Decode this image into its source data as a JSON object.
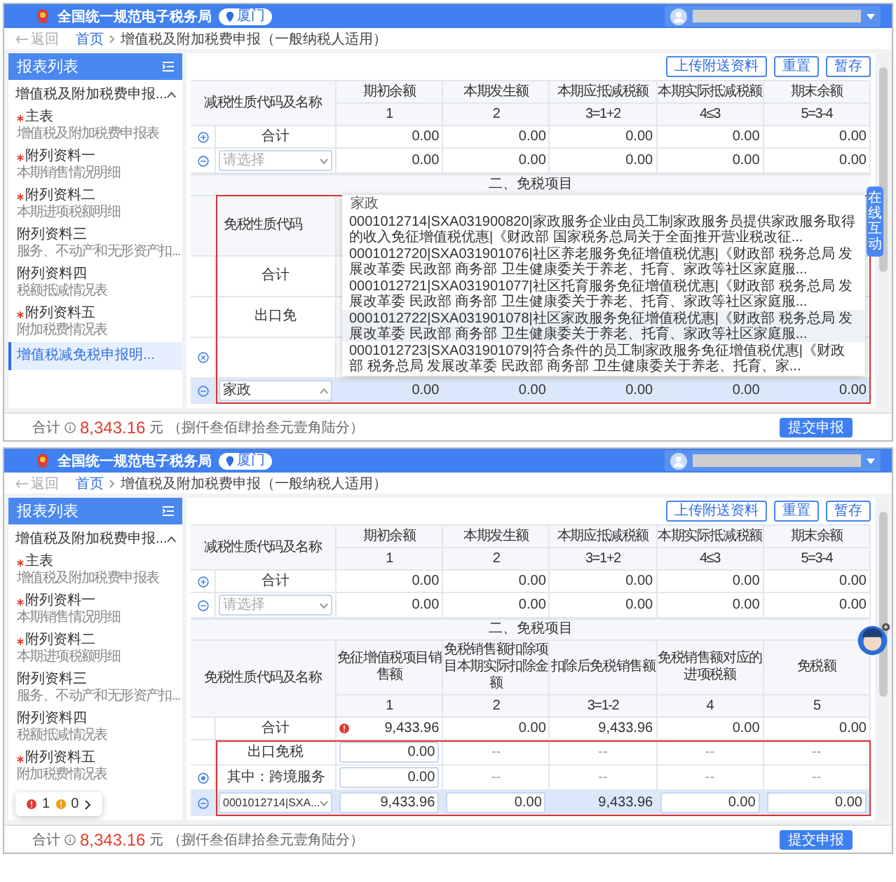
{
  "panels": [
    {
      "header": {
        "title": "全国统一规范电子税务局",
        "city": "厦门"
      },
      "breadcrumb": {
        "back": "返回",
        "home": "首页",
        "current": "增值税及附加税费申报（一般纳税人适用）"
      },
      "sidebar": {
        "title": "报表列表",
        "group": "增值税及附加税费申报...",
        "items": [
          {
            "title": "主表",
            "subtitle": "增值税及附加税费申报表",
            "required": true,
            "selected": false
          },
          {
            "title": "附列资料一",
            "subtitle": "本期销售情况明细",
            "required": true,
            "selected": false
          },
          {
            "title": "附列资料二",
            "subtitle": "本期进项税额明细",
            "required": true,
            "selected": false
          },
          {
            "title": "附列资料三",
            "subtitle": "服务、不动产和无形资产扣...",
            "required": false,
            "selected": false
          },
          {
            "title": "附列资料四",
            "subtitle": "税额抵减情况表",
            "required": false,
            "selected": false
          },
          {
            "title": "附列资料五",
            "subtitle": "附加税费情况表",
            "required": true,
            "selected": false
          },
          {
            "title": "增值税减免税申报明...",
            "required": false,
            "selected": true
          }
        ]
      },
      "toolbar": [
        "上传附送资料",
        "重置",
        "暂存"
      ],
      "table1": {
        "name_header": "减税性质代码及名称",
        "columns": [
          {
            "label": "期初余额",
            "index": "1"
          },
          {
            "label": "本期发生额",
            "index": "2"
          },
          {
            "label": "本期应抵减税额",
            "index": "3=1+2"
          },
          {
            "label": "本期实际抵减税额",
            "index": "4≤3"
          },
          {
            "label": "期末余额",
            "index": "5=3-4"
          }
        ],
        "rows": [
          {
            "kind": "group-total",
            "label": "合计",
            "selected": false,
            "cells": [
              {
                "kind": "text",
                "text": "0.00"
              },
              {
                "kind": "text",
                "text": "0.00"
              },
              {
                "kind": "text",
                "text": "0.00"
              },
              {
                "kind": "text",
                "text": "0.00"
              },
              {
                "kind": "text",
                "text": "0.00"
              }
            ]
          },
          {
            "kind": "select",
            "placeholder": "请选择",
            "selected": false,
            "cells": [
              {
                "kind": "text",
                "text": "0.00"
              },
              {
                "kind": "text",
                "text": "0.00"
              },
              {
                "kind": "text",
                "text": "0.00"
              },
              {
                "kind": "text",
                "text": "0.00"
              },
              {
                "kind": "text",
                "text": "0.00"
              }
            ]
          }
        ]
      },
      "section_title": "二、免税项目",
      "table2": {
        "name_header": "免税性质代码",
        "header_framed": true,
        "rows": [
          {
            "kind": "total",
            "label": "合计",
            "selected": false,
            "framed": true,
            "cells": []
          },
          {
            "kind": "sub",
            "label": "出口免",
            "selected": false,
            "framed": true,
            "cells": []
          },
          {
            "kind": "blank",
            "selected": false,
            "framed": true,
            "cells": []
          },
          {
            "kind": "search",
            "value": "家政",
            "selected": true,
            "framed": true,
            "cells": [
              {
                "kind": "text",
                "text": "0.00"
              },
              {
                "kind": "text",
                "text": "0.00"
              },
              {
                "kind": "text",
                "text": "0.00"
              },
              {
                "kind": "text",
                "text": "0.00"
              },
              {
                "kind": "text",
                "text": "0.00"
              }
            ]
          }
        ],
        "dropdown": {
          "group": "家政",
          "options": [
            {
              "text": "0001012714|SXA031900820|家政服务企业由员工制家政服务员提供家政服务取得的收入免征增值税优惠|《财政部 国家税务总局关于全面推开营业税改征...",
              "hovered": false
            },
            {
              "text": "0001012720|SXA031901076|社区养老服务免征增值税优惠|《财政部 税务总局 发展改革委 民政部 商务部 卫生健康委关于养老、托育、家政等社区家庭服...",
              "hovered": false
            },
            {
              "text": "0001012721|SXA031901077|社区托育服务免征增值税优惠|《财政部 税务总局 发展改革委 民政部 商务部 卫生健康委关于养老、托育、家政等社区家庭服...",
              "hovered": false
            },
            {
              "text": "0001012722|SXA031901078|社区家政服务免征增值税优惠|《财政部 税务总局 发展改革委 民政部 商务部 卫生健康委关于养老、托育、家政等社区家庭服...",
              "hovered": true
            },
            {
              "text": "0001012723|SXA031901079|符合条件的员工制家政服务免征增值税优惠|《财政部 税务总局 发展改革委 民政部 商务部 卫生健康委关于养老、托育、家...",
              "hovered": false
            }
          ]
        }
      },
      "side_tab": "在线互动",
      "footer": {
        "label": "合计",
        "amount": "8,343.16",
        "unit": "元",
        "words": "（捌仟叁佰肆拾叁元壹角陆分）",
        "button": "提交申报"
      }
    },
    {
      "header": {
        "title": "全国统一规范电子税务局",
        "city": "厦门"
      },
      "breadcrumb": {
        "back": "返回",
        "home": "首页",
        "current": "增值税及附加税费申报（一般纳税人适用）"
      },
      "sidebar": {
        "title": "报表列表",
        "group": "增值税及附加税费申报...",
        "items": [
          {
            "title": "主表",
            "subtitle": "增值税及附加税费申报表",
            "required": true,
            "selected": false
          },
          {
            "title": "附列资料一",
            "subtitle": "本期销售情况明细",
            "required": true,
            "selected": false
          },
          {
            "title": "附列资料二",
            "subtitle": "本期进项税额明细",
            "required": true,
            "selected": false
          },
          {
            "title": "附列资料三",
            "subtitle": "服务、不动产和无形资产扣...",
            "required": false,
            "selected": false
          },
          {
            "title": "附列资料四",
            "subtitle": "税额抵减情况表",
            "required": false,
            "selected": false
          },
          {
            "title": "附列资料五",
            "subtitle": "附加税费情况表",
            "required": true,
            "selected": false
          }
        ]
      },
      "toolbar": [
        "上传附送资料",
        "重置",
        "暂存"
      ],
      "table1": {
        "name_header": "减税性质代码及名称",
        "columns": [
          {
            "label": "期初余额",
            "index": "1"
          },
          {
            "label": "本期发生额",
            "index": "2"
          },
          {
            "label": "本期应抵减税额",
            "index": "3=1+2"
          },
          {
            "label": "本期实际抵减税额",
            "index": "4≤3"
          },
          {
            "label": "期末余额",
            "index": "5=3-4"
          }
        ],
        "rows": [
          {
            "kind": "group-total",
            "label": "合计",
            "selected": false,
            "cells": [
              {
                "kind": "text",
                "text": "0.00"
              },
              {
                "kind": "text",
                "text": "0.00"
              },
              {
                "kind": "text",
                "text": "0.00"
              },
              {
                "kind": "text",
                "text": "0.00"
              },
              {
                "kind": "text",
                "text": "0.00"
              }
            ]
          },
          {
            "kind": "select",
            "placeholder": "请选择",
            "selected": false,
            "cells": [
              {
                "kind": "text",
                "text": "0.00"
              },
              {
                "kind": "text",
                "text": "0.00"
              },
              {
                "kind": "text",
                "text": "0.00"
              },
              {
                "kind": "text",
                "text": "0.00"
              },
              {
                "kind": "text",
                "text": "0.00"
              }
            ]
          }
        ]
      },
      "section_title": "二、免税项目",
      "table2": {
        "name_header": "免税性质代码及名称",
        "header_framed": false,
        "columns": [
          {
            "label": "免征增值税项目销售额",
            "index": "1"
          },
          {
            "label": "免税销售额扣除项目本期实际扣除金额",
            "index": "2"
          },
          {
            "label": "扣除后免税销售额",
            "index": "3=1-2"
          },
          {
            "label": "免税销售额对应的进项税额",
            "index": "4"
          },
          {
            "label": "免税额",
            "index": "5"
          }
        ],
        "rows": [
          {
            "kind": "total",
            "label": "合计",
            "selected": false,
            "framed": false,
            "cells": [
              {
                "kind": "text",
                "text": "9,433.96",
                "error": true
              },
              {
                "kind": "text",
                "text": "0.00"
              },
              {
                "kind": "text",
                "text": "9,433.96"
              },
              {
                "kind": "text",
                "text": "0.00"
              },
              {
                "kind": "text",
                "text": "0.00"
              }
            ]
          },
          {
            "kind": "sub",
            "label": "出口免税",
            "selected": false,
            "framed": true,
            "cells": [
              {
                "kind": "input",
                "text": "0.00"
              },
              {
                "kind": "dash",
                "text": "--"
              },
              {
                "kind": "dash",
                "text": "--"
              },
              {
                "kind": "dash",
                "text": "--"
              },
              {
                "kind": "dash",
                "text": "--"
              }
            ]
          },
          {
            "kind": "subitem",
            "label": "其中：跨境服务",
            "selected": false,
            "framed": true,
            "cells": [
              {
                "kind": "input",
                "text": "0.00"
              },
              {
                "kind": "dash",
                "text": "--"
              },
              {
                "kind": "dash",
                "text": "--"
              },
              {
                "kind": "dash",
                "text": "--"
              },
              {
                "kind": "dash",
                "text": "--"
              }
            ]
          },
          {
            "kind": "select",
            "value": "0001012714|SXA...",
            "selected": true,
            "framed": true,
            "cells": [
              {
                "kind": "input",
                "text": "9,433.96"
              },
              {
                "kind": "input",
                "text": "0.00"
              },
              {
                "kind": "text",
                "text": "9,433.96"
              },
              {
                "kind": "input",
                "text": "0.00"
              },
              {
                "kind": "input",
                "text": "0.00"
              }
            ]
          }
        ]
      },
      "assistant": true,
      "status_popup": {
        "errors": "1",
        "warnings": "0"
      },
      "footer": {
        "label": "合计",
        "amount": "8,343.16",
        "unit": "元",
        "words": "（捌仟叁佰肆拾叁元壹角陆分）",
        "button": "提交申报"
      }
    }
  ]
}
